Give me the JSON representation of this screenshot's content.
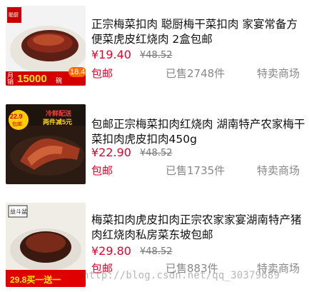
{
  "products": [
    {
      "title": "正宗梅菜扣肉 聪厨梅干菜扣肉 家宴常备方便菜虎皮红烧肉 2盒包邮",
      "price": "¥19.40",
      "original_price": "¥48.52",
      "shipping": "包邮",
      "sold": "已售2748件",
      "shop": "特卖商场",
      "image_text": {
        "brand": "聪厨",
        "sales_prefix": "月销",
        "sales": "15000",
        "sales_unit": "碗",
        "deal": "18.4"
      }
    },
    {
      "title": "包邮正宗梅菜扣肉红烧肉 湖南特产农家梅干菜扣肉虎皮扣肉450g",
      "price": "¥22.90",
      "original_price": "¥48.52",
      "shipping": "包邮",
      "sold": "已售1735件",
      "shop": "特卖商场",
      "image_text": {
        "badge": "22.9",
        "badge_sub": "包邮",
        "promo1": "冷鲜配送",
        "promo2": "两件减5元"
      }
    },
    {
      "title": "梅菜扣肉虎皮扣肉正宗农家家宴湖南特产猪肉红烧肉私房菜东坡包邮",
      "price": "¥29.80",
      "original_price": "¥48.52",
      "shipping": "包邮",
      "sold": "已售883件",
      "shop": "特卖商场",
      "image_text": {
        "brand": "益斗盆",
        "bottom": "29.8买一送一"
      }
    }
  ],
  "watermark": "http://blog.csdn.net/qq_30379689",
  "colors": {
    "price": "#e4002b",
    "muted": "#888888",
    "title": "#111111"
  }
}
